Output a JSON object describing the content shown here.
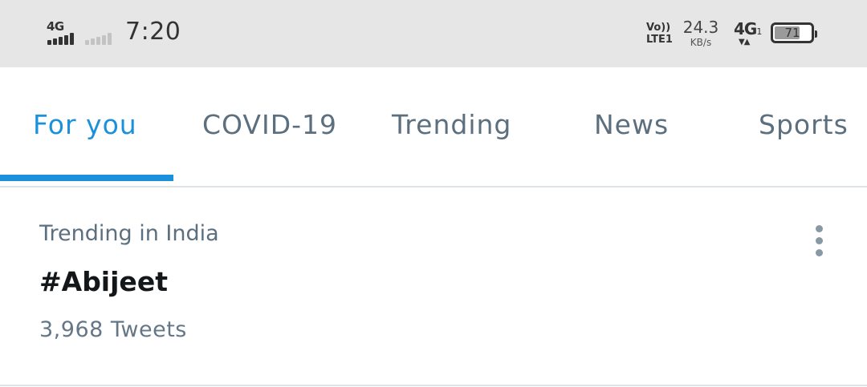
{
  "status_bar": {
    "sim1_network": "4G",
    "sim1_signal_level": 4,
    "sim2_signal_level": 0,
    "time": "7:20",
    "volte_label_top": "Vo))",
    "volte_label_bottom": "LTE1",
    "speed_value": "24.3",
    "speed_unit": "KB/s",
    "data_network": "4G",
    "data_network_sub": "1",
    "data_arrows": "▼▲",
    "battery_percent": "71",
    "battery_level": 0.71
  },
  "tabs": [
    {
      "label": "For you",
      "active": true
    },
    {
      "label": "COVID-19",
      "active": false
    },
    {
      "label": "Trending",
      "active": false
    },
    {
      "label": "News",
      "active": false
    },
    {
      "label": "Sports",
      "active": false
    }
  ],
  "trend": {
    "context": "Trending in India",
    "name": "#Abijeet",
    "count": "3,968 Tweets",
    "more_icon": "vertical-ellipsis"
  },
  "colors": {
    "accent": "#1a91da",
    "tab_text": "#5b6f7f",
    "status_bar_bg": "#e6e6e6",
    "trend_name": "#14171a"
  }
}
